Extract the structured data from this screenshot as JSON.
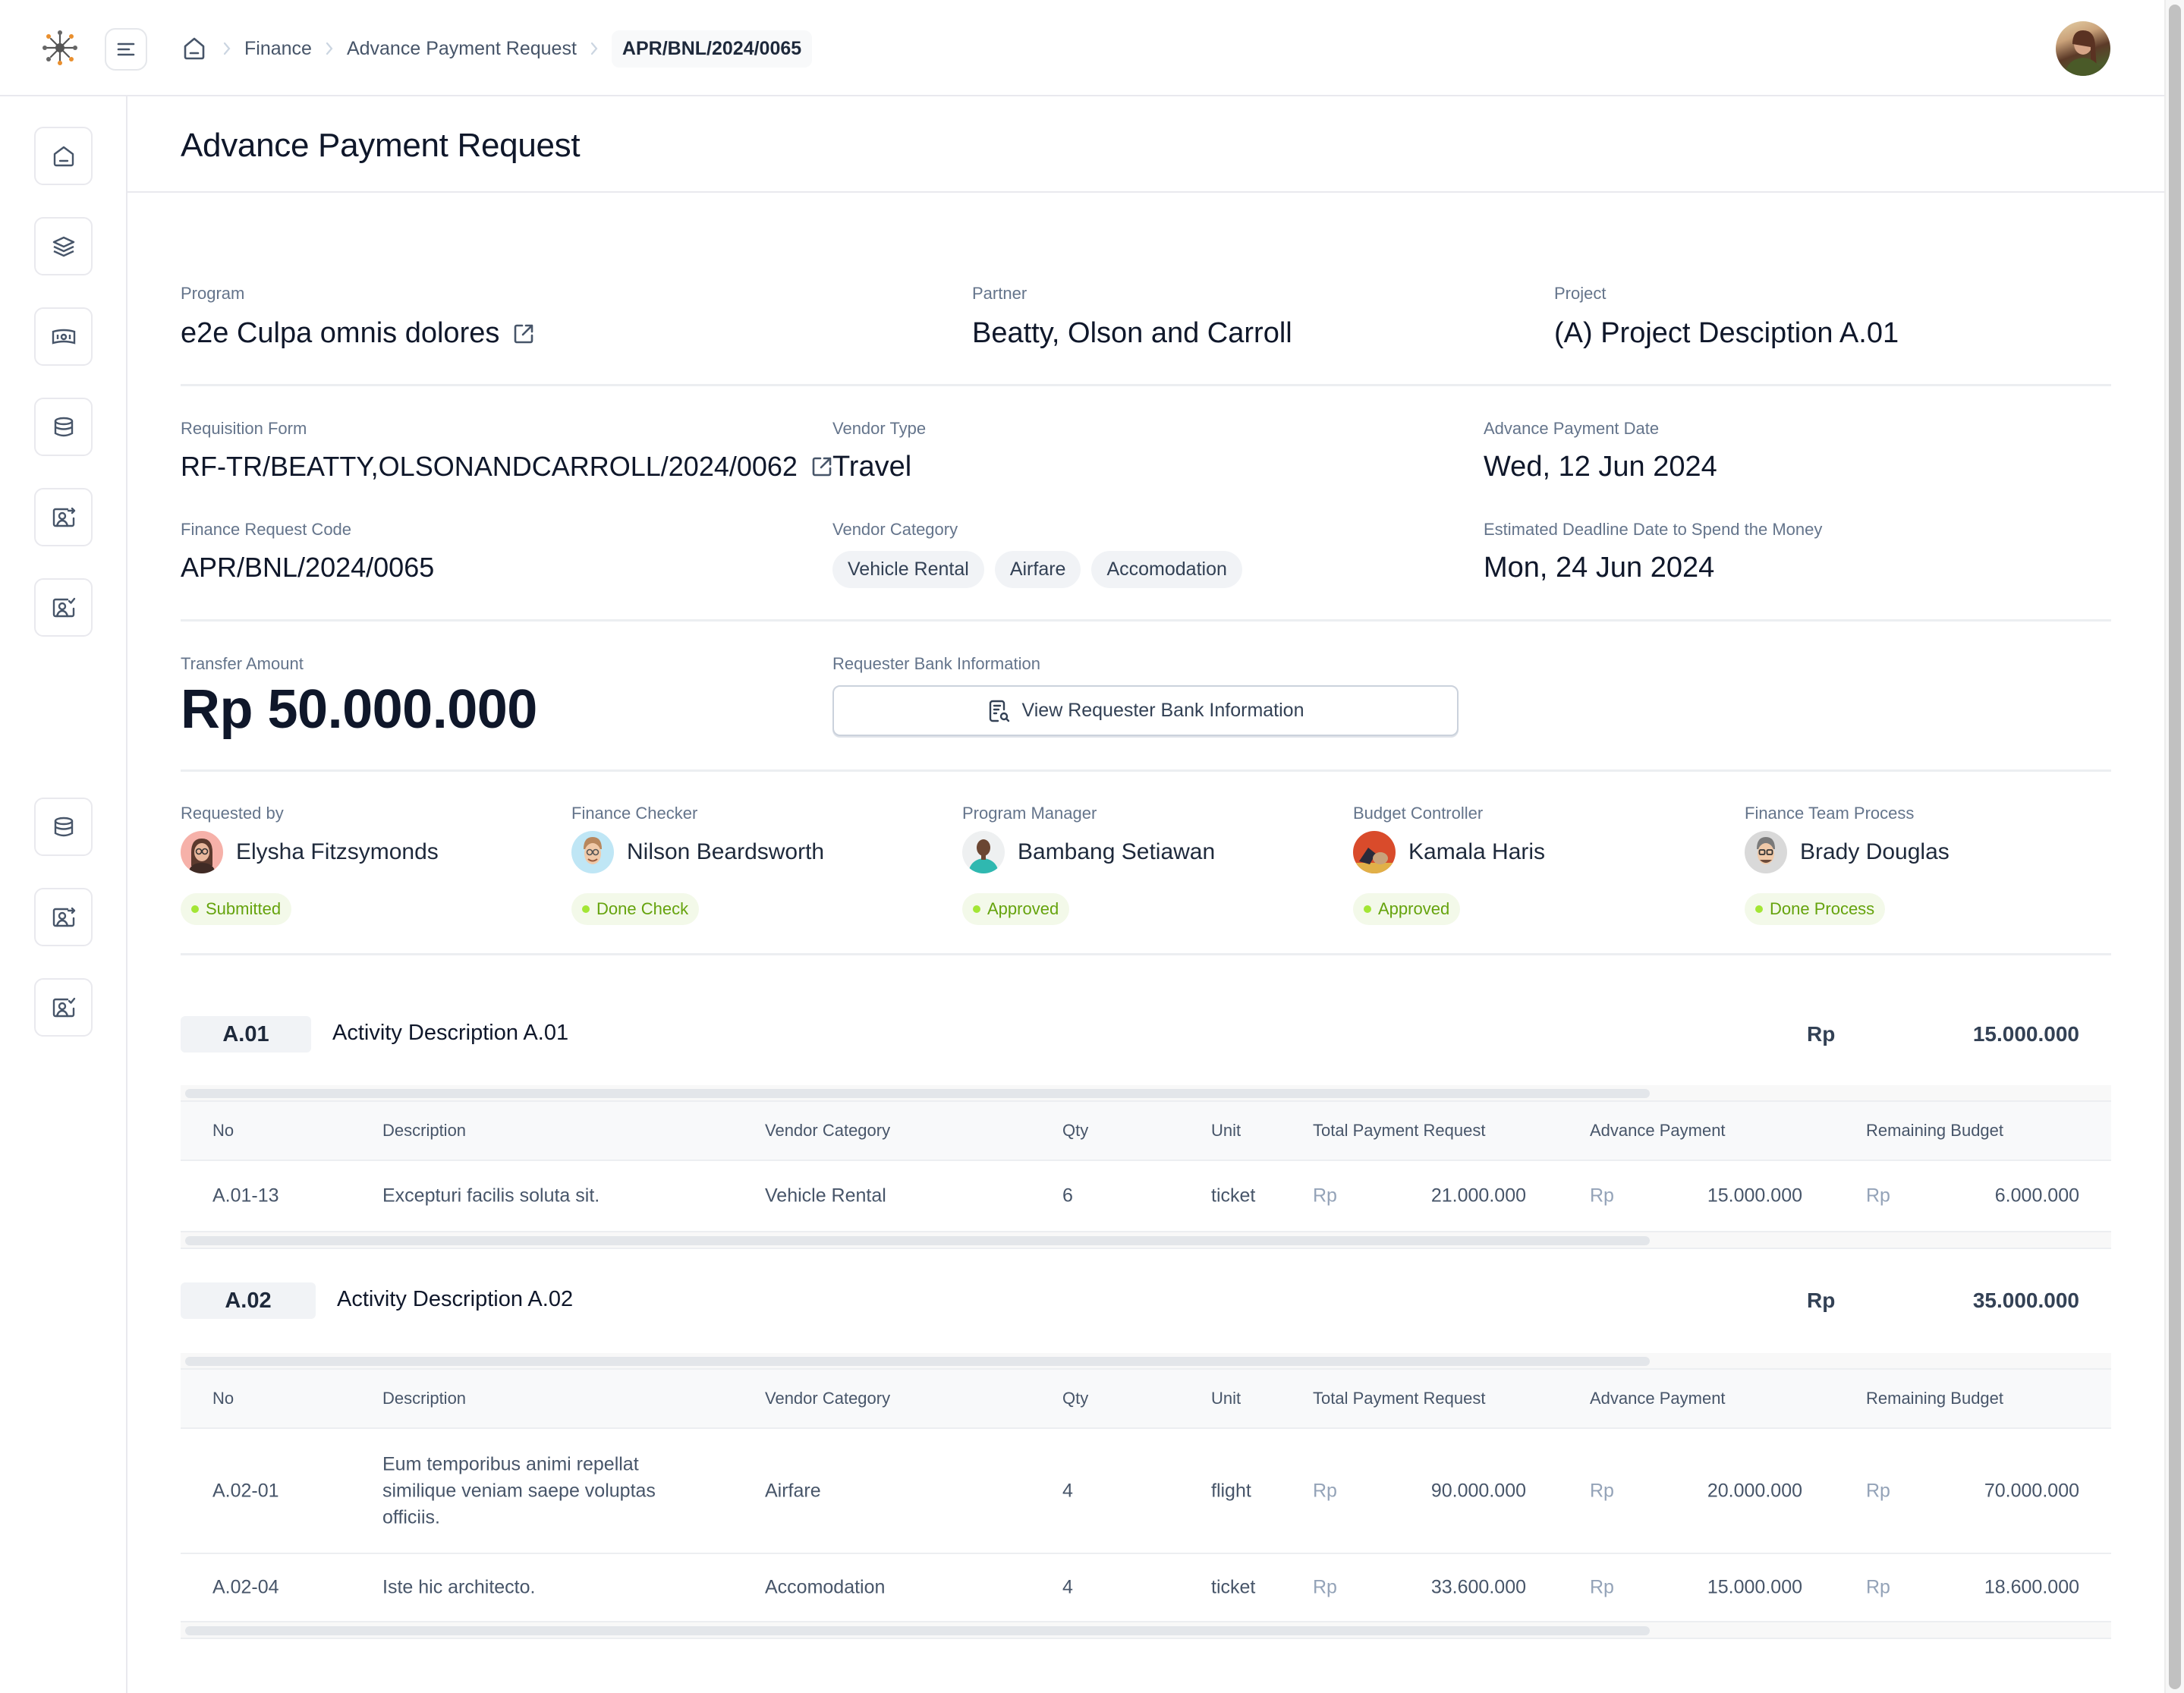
{
  "breadcrumb": {
    "items": [
      "Finance",
      "Advance Payment Request"
    ],
    "current": "APR/BNL/2024/0065"
  },
  "page": {
    "title": "Advance Payment Request"
  },
  "sidebar": {
    "top_icons": [
      "home-icon",
      "layers-icon",
      "money-icon",
      "database-icon",
      "user-card-arrow-icon",
      "user-card-check-icon"
    ],
    "bottom_icons": [
      "database-icon",
      "user-card-arrow-icon",
      "user-card-check-icon"
    ]
  },
  "info": {
    "program": {
      "label": "Program",
      "value": "e2e Culpa omnis dolores"
    },
    "partner": {
      "label": "Partner",
      "value": "Beatty, Olson and Carroll"
    },
    "project": {
      "label": "Project",
      "value": "(A) Project Desciption A.01"
    },
    "requisition_form": {
      "label": "Requisition Form",
      "value": "RF-TR/BEATTY,OLSONANDCARROLL/2024/0062"
    },
    "vendor_type": {
      "label": "Vendor Type",
      "value": "Travel"
    },
    "advance_payment_date": {
      "label": "Advance Payment Date",
      "value": "Wed, 12 Jun 2024"
    },
    "finance_request_code": {
      "label": "Finance Request Code",
      "value": "APR/BNL/2024/0065"
    },
    "vendor_category": {
      "label": "Vendor Category",
      "chips": [
        "Vehicle Rental",
        "Airfare",
        "Accomodation"
      ]
    },
    "deadline": {
      "label": "Estimated Deadline Date to Spend the Money",
      "value": "Mon, 24 Jun 2024"
    },
    "transfer_amount": {
      "label": "Transfer Amount",
      "value": "Rp 50.000.000"
    },
    "bank_info": {
      "label": "Requester Bank Information",
      "button": "View Requester Bank Information"
    }
  },
  "approvers": [
    {
      "role": "Requested by",
      "name": "Elysha Fitzsymonds",
      "status": "Submitted"
    },
    {
      "role": "Finance Checker",
      "name": "Nilson Beardsworth",
      "status": "Done Check"
    },
    {
      "role": "Program Manager",
      "name": "Bambang Setiawan",
      "status": "Approved"
    },
    {
      "role": "Budget Controller",
      "name": "Kamala Haris",
      "status": "Approved"
    },
    {
      "role": "Finance Team Process",
      "name": "Brady Douglas",
      "status": "Done Process"
    }
  ],
  "table_headers": [
    "No",
    "Description",
    "Vendor Category",
    "Qty",
    "Unit",
    "Total Payment Request",
    "Advance Payment",
    "Remaining Budget"
  ],
  "currency": "Rp",
  "activities": [
    {
      "code": "A.01",
      "description": "Activity Description A.01",
      "total": "15.000.000",
      "rows": [
        {
          "no": "A.01-13",
          "description": "Excepturi facilis soluta sit.",
          "vendor_category": "Vehicle Rental",
          "qty": "6",
          "unit": "ticket",
          "total_payment_request": "21.000.000",
          "advance_payment": "15.000.000",
          "remaining_budget": "6.000.000"
        }
      ]
    },
    {
      "code": "A.02",
      "description": "Activity Description A.02",
      "total": "35.000.000",
      "rows": [
        {
          "no": "A.02-01",
          "description": "Eum temporibus animi repellat similique veniam saepe voluptas officiis.",
          "vendor_category": "Airfare",
          "qty": "4",
          "unit": "flight",
          "total_payment_request": "90.000.000",
          "advance_payment": "20.000.000",
          "remaining_budget": "70.000.000"
        },
        {
          "no": "A.02-04",
          "description": "Iste hic architecto.",
          "vendor_category": "Accomodation",
          "qty": "4",
          "unit": "ticket",
          "total_payment_request": "33.600.000",
          "advance_payment": "15.000.000",
          "remaining_budget": "18.600.000"
        }
      ]
    }
  ],
  "colors": {
    "status_bg": "#f3f9e9",
    "status_text": "#65a30d",
    "status_dot": "#a3e635",
    "chip_bg": "#f1f3f6"
  }
}
